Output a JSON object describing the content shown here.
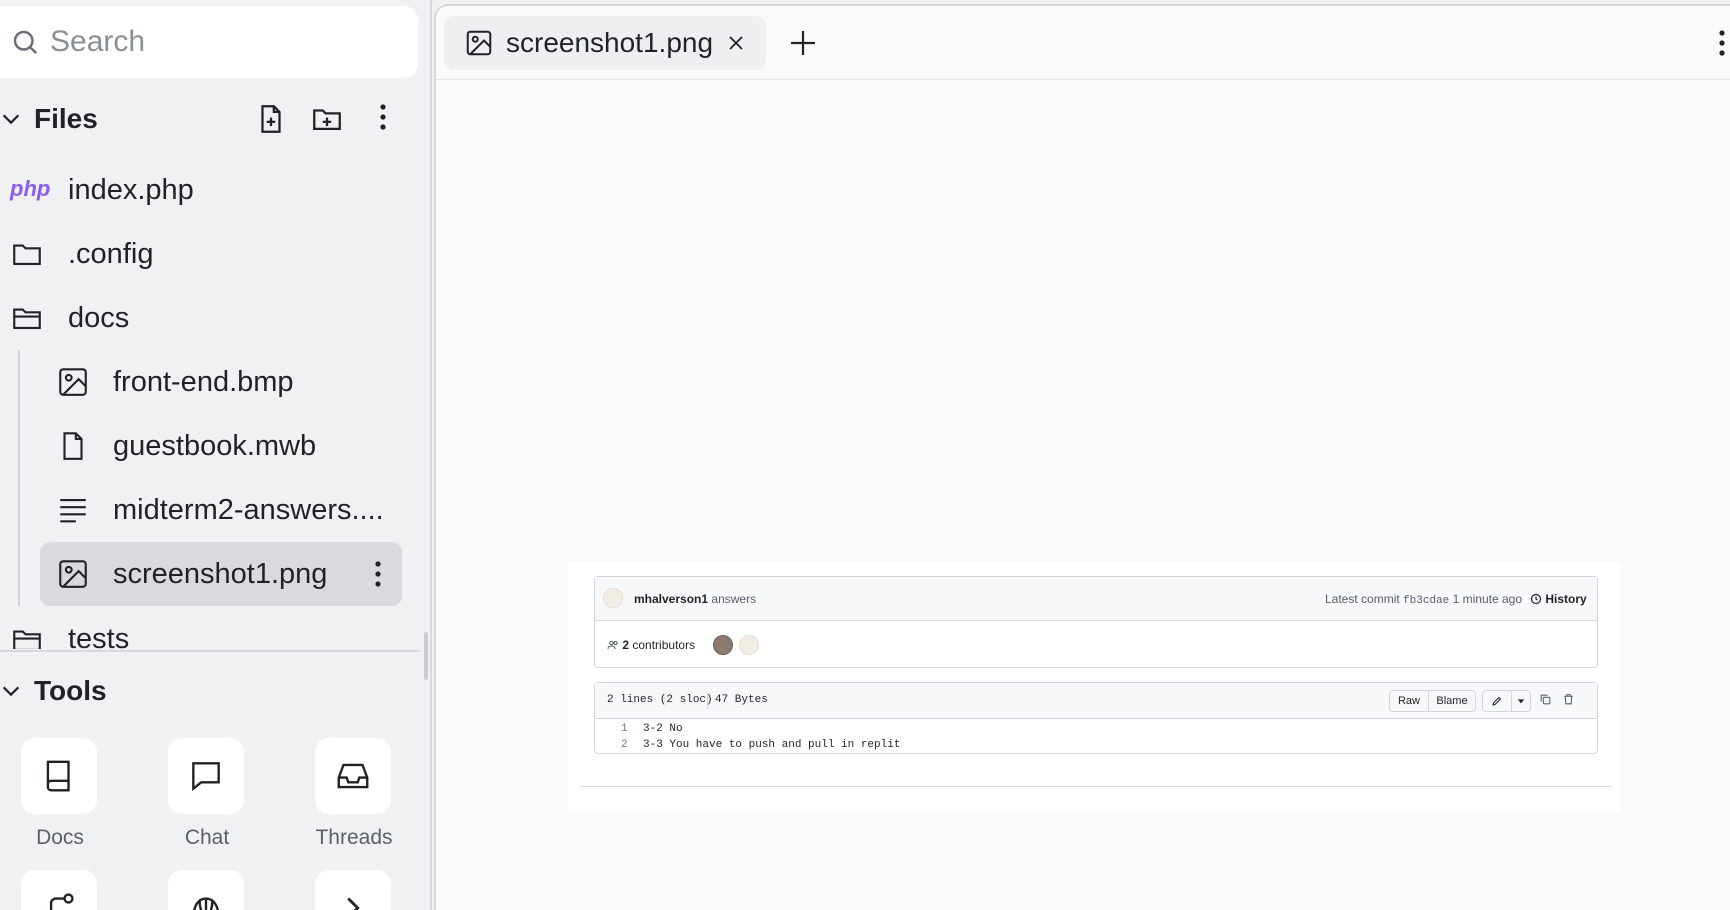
{
  "sidebar": {
    "search_placeholder": "Search",
    "files_title": "Files",
    "items": [
      {
        "label": "index.php",
        "icon": "php-icon"
      },
      {
        "label": ".config",
        "icon": "folder-icon"
      },
      {
        "label": "docs",
        "icon": "folder-open-icon"
      },
      {
        "label": "front-end.bmp",
        "icon": "image-icon"
      },
      {
        "label": "guestbook.mwb",
        "icon": "file-icon"
      },
      {
        "label": "midterm2-answers....",
        "icon": "text-file-icon"
      },
      {
        "label": "screenshot1.png",
        "icon": "image-icon",
        "selected": true
      },
      {
        "label": "tests",
        "icon": "folder-icon"
      }
    ],
    "tools_title": "Tools",
    "tools": [
      {
        "label": "Docs",
        "icon": "book-icon"
      },
      {
        "label": "Chat",
        "icon": "chat-icon"
      },
      {
        "label": "Threads",
        "icon": "inbox-icon"
      }
    ]
  },
  "editor": {
    "tab_label": "screenshot1.png"
  },
  "image": {
    "author": "mhalverson1",
    "commit_message": "answers",
    "latest_commit_label": "Latest commit",
    "commit_hash": "fb3cdae",
    "commit_time": "1 minute ago",
    "history_label": "History",
    "contributors_count": "2",
    "contributors_label": "contributors",
    "lines_info": "2 lines (2 sloc)",
    "size_info": "47 Bytes",
    "raw_label": "Raw",
    "blame_label": "Blame",
    "code_lines": [
      {
        "no": "1",
        "text": "3-2 No"
      },
      {
        "no": "2",
        "text": "3-3 You have to push and pull in replit"
      }
    ]
  }
}
